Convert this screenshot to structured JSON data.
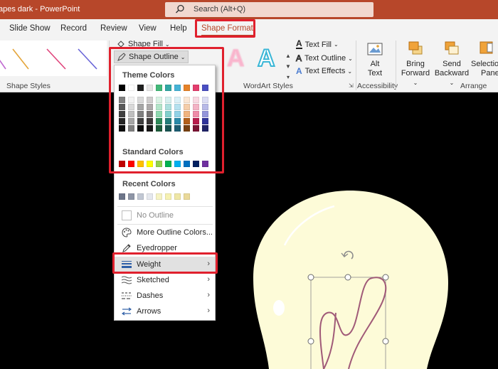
{
  "titlebar": {
    "document_name": "apes dark",
    "separator": " - ",
    "app_name": "PowerPoint",
    "search_placeholder": "Search (Alt+Q)",
    "bg": "#b7472a"
  },
  "tabs": [
    {
      "label": "Slide Show"
    },
    {
      "label": "Record"
    },
    {
      "label": "Review"
    },
    {
      "label": "View"
    },
    {
      "label": "Help"
    },
    {
      "label": "Shape Format",
      "active": true
    }
  ],
  "ribbon": {
    "shape_fill": "Shape Fill",
    "shape_outline": "Shape Outline",
    "shape_styles_label": "Shape Styles",
    "text_fill": "Text Fill",
    "text_outline": "Text Outline",
    "text_effects": "Text Effects",
    "wordart_label": "WordArt Styles",
    "wordart_letters": [
      "A",
      "A"
    ],
    "alt_text_l1": "Alt",
    "alt_text_l2": "Text",
    "accessibility_label": "Accessibility",
    "bring_forward_l1": "Bring",
    "bring_forward_l2": "Forward",
    "send_backward_l1": "Send",
    "send_backward_l2": "Backward",
    "selection_pane_l1": "Selection",
    "selection_pane_l2": "Pane",
    "arrange_label": "Arrange"
  },
  "dropdown": {
    "theme_colors_label": "Theme Colors",
    "standard_colors_label": "Standard Colors",
    "recent_colors_label": "Recent Colors",
    "theme_top_row": [
      "#000000",
      "#ffffff",
      "#1f1f1f",
      "#e7e6e6",
      "#43b878",
      "#31a7a3",
      "#46b3d6",
      "#e6832a",
      "#e33e6e",
      "#4a4fc2"
    ],
    "theme_shades": [
      [
        "#7f7f7f",
        "#595959",
        "#404040",
        "#262626",
        "#0d0d0d"
      ],
      [
        "#f2f2f2",
        "#d9d9d9",
        "#bfbfbf",
        "#a6a6a6",
        "#808080"
      ],
      [
        "#d9d9d9",
        "#a6a6a6",
        "#7f7f7f",
        "#404040",
        "#0d0d0d"
      ],
      [
        "#d0cece",
        "#aeabab",
        "#757070",
        "#3b3838",
        "#171616"
      ],
      [
        "#d9f2e4",
        "#b3e5c9",
        "#8ed8af",
        "#2e8a59",
        "#1e5c3b"
      ],
      [
        "#d5efee",
        "#abdfdd",
        "#82cfcc",
        "#247d7a",
        "#185351"
      ],
      [
        "#daf0f7",
        "#b5e1ef",
        "#90d1e6",
        "#2b8aa9",
        "#1d5c71"
      ],
      [
        "#fae6d4",
        "#f5cda9",
        "#f0b47f",
        "#b3601a",
        "#774011"
      ],
      [
        "#f9d8e2",
        "#f3b2c5",
        "#ee8ba8",
        "#b81c4c",
        "#7a1333"
      ],
      [
        "#dbdcf3",
        "#b7b9e7",
        "#9395da",
        "#2f349a",
        "#1f2367"
      ]
    ],
    "standard_colors": [
      "#c00000",
      "#ff0000",
      "#ffc000",
      "#ffff00",
      "#92d050",
      "#00b050",
      "#00b0f0",
      "#0070c0",
      "#002060",
      "#7030a0"
    ],
    "recent_colors": [
      "#6d7589",
      "#8e95a6",
      "#c1c7d3",
      "#e5e8ee",
      "#f6f3c4",
      "#f6f1b2",
      "#efe7a6",
      "#ead99a"
    ],
    "no_outline": "No Outline",
    "more_colors": "More Outline Colors...",
    "eyedropper": "Eyedropper",
    "weight": "Weight",
    "sketched": "Sketched",
    "dashes": "Dashes",
    "arrows": "Arrows",
    "submenu_arrow": "›"
  },
  "slide": {
    "bulb_color": "#fdfbd8",
    "filament_color": "#a05a78",
    "background": "#000000"
  },
  "icons": [
    "search-icon",
    "shape-fill-icon",
    "shape-outline-icon",
    "text-fill-icon",
    "text-outline-icon",
    "text-effects-icon",
    "alt-text-icon",
    "bring-forward-icon",
    "send-backward-icon",
    "selection-pane-icon",
    "more-colors-icon",
    "eyedropper-icon",
    "weight-icon",
    "sketched-icon",
    "dashes-icon",
    "arrows-icon",
    "rotate-handle-icon"
  ]
}
